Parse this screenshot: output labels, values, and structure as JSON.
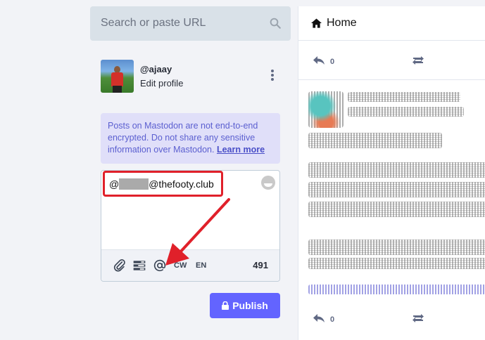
{
  "search": {
    "placeholder": "Search or paste URL"
  },
  "profile": {
    "handle": "@ajaay",
    "edit_label": "Edit profile"
  },
  "notice": {
    "text": "Posts on Mastodon are not end-to-end encrypted. Do not share any sensitive information over Mastodon.",
    "link_label": "Learn more"
  },
  "compose": {
    "mention_prefix": "@",
    "mention_domain": "@thefooty.club",
    "cw_label": "CW",
    "lang_label": "EN",
    "char_count": "491"
  },
  "publish": {
    "label": "Publish"
  },
  "home": {
    "title": "Home",
    "top_reply_count": "0",
    "bottom_reply_count": "0"
  },
  "colors": {
    "accent": "#6364ff",
    "highlight": "#e0202a",
    "notice_bg": "#e0dff9"
  }
}
